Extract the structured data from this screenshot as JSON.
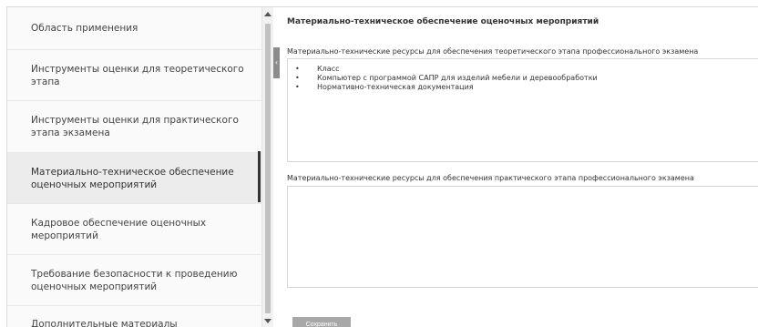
{
  "sidebar": {
    "items": [
      {
        "label": "Область применения"
      },
      {
        "label": "Инструменты оценки для теоретического этапа"
      },
      {
        "label": "Инструменты оценки для практического этапа экзамена"
      },
      {
        "label": "Материально-техническое обеспечение оценочных мероприятий"
      },
      {
        "label": "Кадровое обеспечение оценочных мероприятий"
      },
      {
        "label": "Требование безопасности к проведению оценочных мероприятий"
      },
      {
        "label": "Дополнительные материалы"
      }
    ],
    "active_index": 3
  },
  "main": {
    "title": "Материально-техническое обеспечение оценочных мероприятий",
    "theory": {
      "label": "Материально-технические ресурсы для обеспечения теоретического этапа профессионального экзамена",
      "items": [
        "Класс",
        "Компьютер с программой САПР для изделий мебели и деревообработки",
        "Нормативно-техническая документация"
      ]
    },
    "practice": {
      "label": "Материально-технические ресурсы для обеспечения практического этапа профессионального экзамена",
      "value": ""
    },
    "save_label": "Сохранить"
  }
}
